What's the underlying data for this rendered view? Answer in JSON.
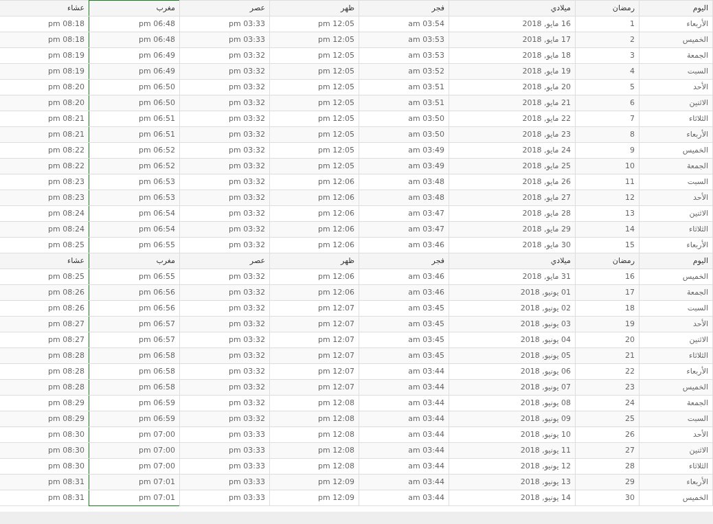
{
  "sections": [
    {
      "columns": [
        {
          "label": "اليوم",
          "selected": false
        },
        {
          "label": "رمضان",
          "selected": false
        },
        {
          "label": "ميلادي",
          "selected": false
        },
        {
          "label": "فجر",
          "selected": false
        },
        {
          "label": "ظهر",
          "selected": false
        },
        {
          "label": "عصر",
          "selected": false
        },
        {
          "label": "مغرب",
          "selected": true
        },
        {
          "label": "عشاء",
          "selected": false
        }
      ],
      "rows": [
        [
          "الأربعاء",
          "1",
          "16 مايو, 2018",
          "03:54 am",
          "12:05 pm",
          "03:33 pm",
          "06:48 pm",
          "08:18 pm"
        ],
        [
          "الخميس",
          "2",
          "17 مايو, 2018",
          "03:53 am",
          "12:05 pm",
          "03:33 pm",
          "06:48 pm",
          "08:18 pm"
        ],
        [
          "الجمعة",
          "3",
          "18 مايو, 2018",
          "03:53 am",
          "12:05 pm",
          "03:32 pm",
          "06:49 pm",
          "08:19 pm"
        ],
        [
          "السبت",
          "4",
          "19 مايو, 2018",
          "03:52 am",
          "12:05 pm",
          "03:32 pm",
          "06:49 pm",
          "08:19 pm"
        ],
        [
          "الأحد",
          "5",
          "20 مايو, 2018",
          "03:51 am",
          "12:05 pm",
          "03:32 pm",
          "06:50 pm",
          "08:20 pm"
        ],
        [
          "الاثنين",
          "6",
          "21 مايو, 2018",
          "03:51 am",
          "12:05 pm",
          "03:32 pm",
          "06:50 pm",
          "08:20 pm"
        ],
        [
          "الثلاثاء",
          "7",
          "22 مايو, 2018",
          "03:50 am",
          "12:05 pm",
          "03:32 pm",
          "06:51 pm",
          "08:21 pm"
        ],
        [
          "الأربعاء",
          "8",
          "23 مايو, 2018",
          "03:50 am",
          "12:05 pm",
          "03:32 pm",
          "06:51 pm",
          "08:21 pm"
        ],
        [
          "الخميس",
          "9",
          "24 مايو, 2018",
          "03:49 am",
          "12:05 pm",
          "03:32 pm",
          "06:52 pm",
          "08:22 pm"
        ],
        [
          "الجمعة",
          "10",
          "25 مايو, 2018",
          "03:49 am",
          "12:05 pm",
          "03:32 pm",
          "06:52 pm",
          "08:22 pm"
        ],
        [
          "السبت",
          "11",
          "26 مايو, 2018",
          "03:48 am",
          "12:06 pm",
          "03:32 pm",
          "06:53 pm",
          "08:23 pm"
        ],
        [
          "الأحد",
          "12",
          "27 مايو, 2018",
          "03:48 am",
          "12:06 pm",
          "03:32 pm",
          "06:53 pm",
          "08:23 pm"
        ],
        [
          "الاثنين",
          "13",
          "28 مايو, 2018",
          "03:47 am",
          "12:06 pm",
          "03:32 pm",
          "06:54 pm",
          "08:24 pm"
        ],
        [
          "الثلاثاء",
          "14",
          "29 مايو, 2018",
          "03:47 am",
          "12:06 pm",
          "03:32 pm",
          "06:54 pm",
          "08:24 pm"
        ],
        [
          "الأربعاء",
          "15",
          "30 مايو, 2018",
          "03:46 am",
          "12:06 pm",
          "03:32 pm",
          "06:55 pm",
          "08:25 pm"
        ]
      ]
    },
    {
      "columns": [
        {
          "label": "اليوم"
        },
        {
          "label": "رمضان"
        },
        {
          "label": "ميلادي"
        },
        {
          "label": "فجر"
        },
        {
          "label": "ظهر"
        },
        {
          "label": "عصر"
        },
        {
          "label": "مغرب"
        },
        {
          "label": "عشاء"
        }
      ],
      "rows": [
        [
          "الخميس",
          "16",
          "31 مايو, 2018",
          "03:46 am",
          "12:06 pm",
          "03:32 pm",
          "06:55 pm",
          "08:25 pm"
        ],
        [
          "الجمعة",
          "17",
          "01 يونيو, 2018",
          "03:46 am",
          "12:06 pm",
          "03:32 pm",
          "06:56 pm",
          "08:26 pm"
        ],
        [
          "السبت",
          "18",
          "02 يونيو, 2018",
          "03:45 am",
          "12:07 pm",
          "03:32 pm",
          "06:56 pm",
          "08:26 pm"
        ],
        [
          "الأحد",
          "19",
          "03 يونيو, 2018",
          "03:45 am",
          "12:07 pm",
          "03:32 pm",
          "06:57 pm",
          "08:27 pm"
        ],
        [
          "الاثنين",
          "20",
          "04 يونيو, 2018",
          "03:45 am",
          "12:07 pm",
          "03:32 pm",
          "06:57 pm",
          "08:27 pm"
        ],
        [
          "الثلاثاء",
          "21",
          "05 يونيو, 2018",
          "03:45 am",
          "12:07 pm",
          "03:32 pm",
          "06:58 pm",
          "08:28 pm"
        ],
        [
          "الأربعاء",
          "22",
          "06 يونيو, 2018",
          "03:44 am",
          "12:07 pm",
          "03:32 pm",
          "06:58 pm",
          "08:28 pm"
        ],
        [
          "الخميس",
          "23",
          "07 يونيو, 2018",
          "03:44 am",
          "12:07 pm",
          "03:32 pm",
          "06:58 pm",
          "08:28 pm"
        ],
        [
          "الجمعة",
          "24",
          "08 يونيو, 2018",
          "03:44 am",
          "12:08 pm",
          "03:32 pm",
          "06:59 pm",
          "08:29 pm"
        ],
        [
          "السبت",
          "25",
          "09 يونيو, 2018",
          "03:44 am",
          "12:08 pm",
          "03:32 pm",
          "06:59 pm",
          "08:29 pm"
        ],
        [
          "الأحد",
          "26",
          "10 يونيو, 2018",
          "03:44 am",
          "12:08 pm",
          "03:33 pm",
          "07:00 pm",
          "08:30 pm"
        ],
        [
          "الاثنين",
          "27",
          "11 يونيو, 2018",
          "03:44 am",
          "12:08 pm",
          "03:33 pm",
          "07:00 pm",
          "08:30 pm"
        ],
        [
          "الثلاثاء",
          "28",
          "12 يونيو, 2018",
          "03:44 am",
          "12:08 pm",
          "03:33 pm",
          "07:00 pm",
          "08:30 pm"
        ],
        [
          "الأربعاء",
          "29",
          "13 يونيو, 2018",
          "03:44 am",
          "12:09 pm",
          "03:33 pm",
          "07:01 pm",
          "08:31 pm"
        ],
        [
          "الخميس",
          "30",
          "14 يونيو, 2018",
          "03:44 am",
          "12:09 pm",
          "03:33 pm",
          "07:01 pm",
          "08:31 pm"
        ]
      ]
    }
  ]
}
